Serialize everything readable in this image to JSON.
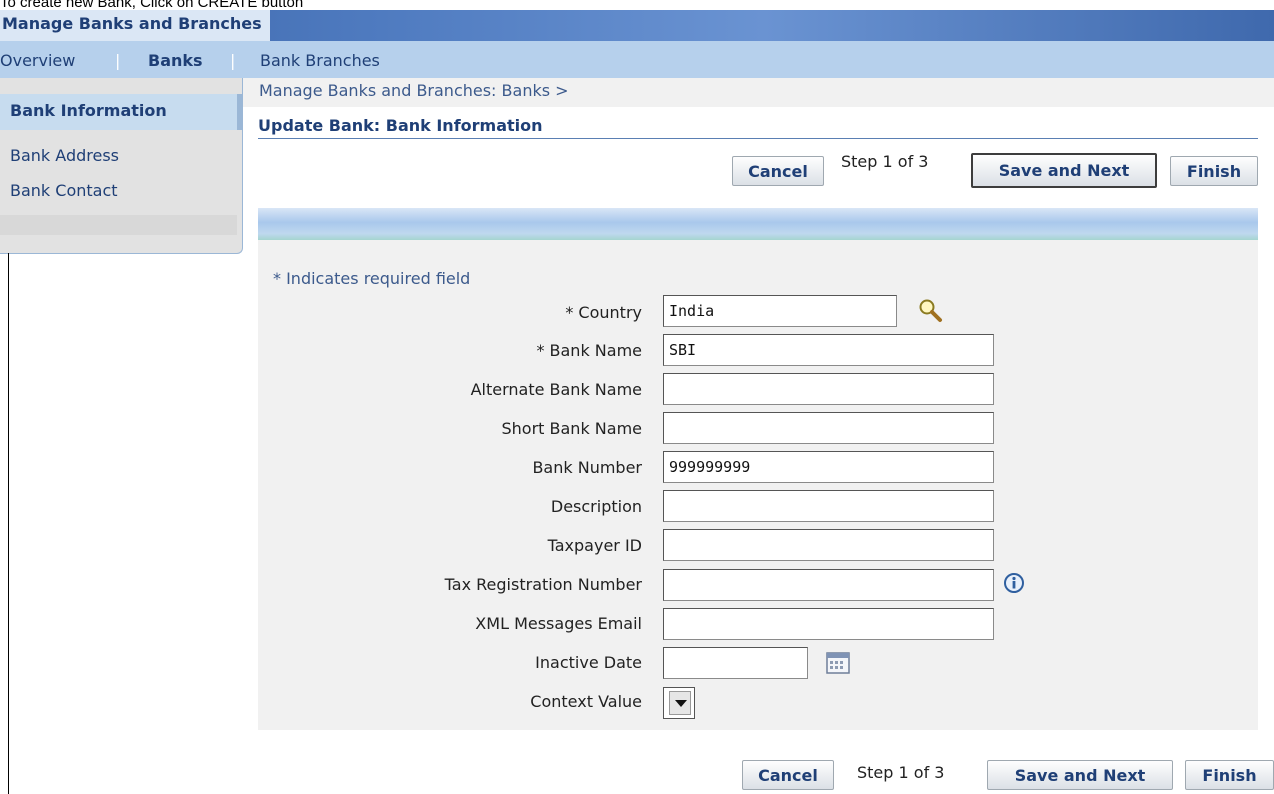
{
  "caption": "To create new Bank, Click on CREATE button",
  "header": {
    "tab_title": "Manage Banks and Branches"
  },
  "nav": {
    "overview": "Overview",
    "banks": "Banks",
    "bank_branches": "Bank Branches",
    "separator": "|"
  },
  "breadcrumb": "Manage Banks and Branches: Banks  >",
  "sidebar": {
    "items": [
      {
        "label": "Bank Information",
        "active": true
      },
      {
        "label": "Bank Address",
        "active": false
      },
      {
        "label": "Bank Contact",
        "active": false
      }
    ]
  },
  "page_title": "Update Bank: Bank Information",
  "toolbar": {
    "cancel": "Cancel",
    "step": "Step 1 of 3",
    "save_next": "Save and Next",
    "finish": "Finish"
  },
  "form": {
    "required_note": "* Indicates required field",
    "fields": [
      {
        "label": "* Country",
        "value": "India"
      },
      {
        "label": "* Bank Name",
        "value": "SBI"
      },
      {
        "label": "Alternate Bank Name",
        "value": ""
      },
      {
        "label": "Short Bank Name",
        "value": ""
      },
      {
        "label": "Bank Number",
        "value": "999999999"
      },
      {
        "label": "Description",
        "value": ""
      },
      {
        "label": "Taxpayer ID",
        "value": ""
      },
      {
        "label": "Tax Registration Number",
        "value": ""
      },
      {
        "label": "XML Messages Email",
        "value": ""
      },
      {
        "label": "Inactive Date",
        "value": ""
      },
      {
        "label": "Context Value",
        "value": ""
      }
    ]
  },
  "icons": {
    "search": "search-icon",
    "info": "info-icon",
    "calendar": "calendar-icon"
  },
  "colors": {
    "accent": "#1f3f76",
    "nav_bg": "#b6d0ec",
    "title_bar": "#4f7bc0"
  }
}
